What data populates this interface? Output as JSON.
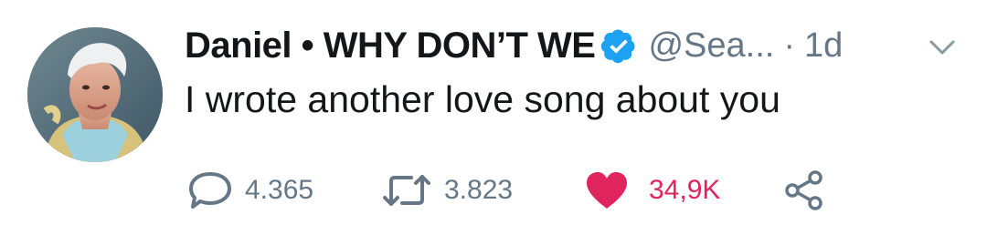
{
  "tweet": {
    "display_name": "Daniel • WHY DON’T WE",
    "handle": "@Sea...",
    "separator": "·",
    "time": "1d",
    "text": "I wrote another love song about you",
    "reply_count": "4.365",
    "retweet_count": "3.823",
    "like_count": "34,9K"
  },
  "icons": {
    "verified": "verified-badge-icon",
    "caret": "chevron-down-icon",
    "reply": "reply-bubble-icon",
    "retweet": "retweet-icon",
    "like": "heart-icon",
    "share": "share-icon"
  },
  "colors": {
    "text": "#14171a",
    "secondary": "#657786",
    "verified": "#1da1f2",
    "like": "#e0245e"
  }
}
